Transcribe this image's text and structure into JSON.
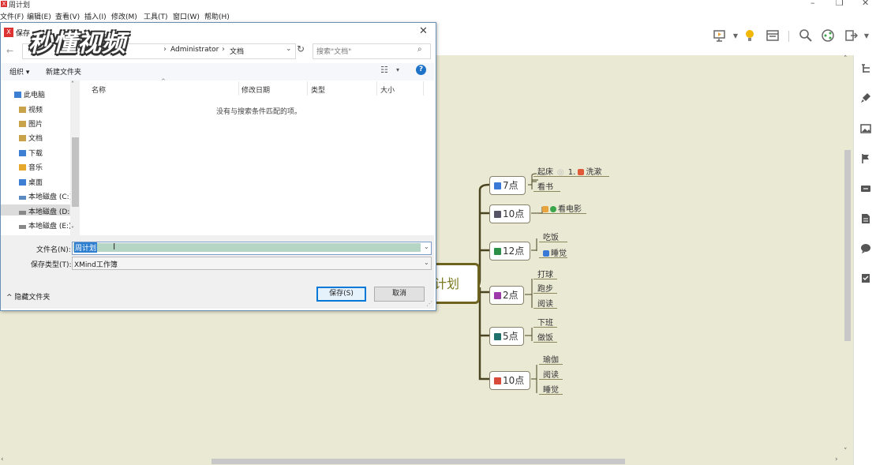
{
  "app": {
    "window_title": "周计划",
    "logo_glyph": "X",
    "win_minimize": "–",
    "win_restore": "❐",
    "win_close": "✕"
  },
  "menu": [
    "文件(F)",
    "编辑(E)",
    "查看(V)",
    "插入(I)",
    "修改(M)",
    "工具(T)",
    "窗口(W)",
    "帮助(H)"
  ],
  "toolbar_icons": [
    "presentation-icon",
    "lightbulb-icon",
    "layout-icon",
    "zoom-icon",
    "share-icon",
    "export-icon"
  ],
  "right_panel_icons": [
    "outline-icon",
    "format-brush-icon",
    "image-icon",
    "flag-icon",
    "label-icon",
    "note-icon",
    "comment-icon",
    "task-icon"
  ],
  "watermark": "秒懂视频",
  "dialog": {
    "title": "保存",
    "icon_glyph": "X",
    "close": "✕",
    "back": "←",
    "breadcrumb_sep": "›",
    "breadcrumb": [
      "Administrator",
      "文档"
    ],
    "address_dropdown": "⌄",
    "refresh": "↻",
    "search_placeholder": "搜索\"文档\"",
    "search_icon": "⌕",
    "organize": "组织 ▾",
    "new_folder": "新建文件夹",
    "view_icon": "☷",
    "view_dropdown": "▾",
    "help": "?",
    "nav_scroll_up": "˄",
    "nav_scroll_down": "˅",
    "nav_items": [
      {
        "label": "此电脑",
        "color": "#3c7fd3"
      },
      {
        "label": "视频",
        "color": "#c9a34a"
      },
      {
        "label": "图片",
        "color": "#c9a34a"
      },
      {
        "label": "文档",
        "color": "#c9a34a"
      },
      {
        "label": "下载",
        "color": "#3c7fd3"
      },
      {
        "label": "音乐",
        "color": "#e6a92e"
      },
      {
        "label": "桌面",
        "color": "#3c7fd3"
      },
      {
        "label": "本地磁盘 (C:)",
        "color": "#5a8ac0"
      },
      {
        "label": "本地磁盘 (D:)",
        "color": "#888888"
      },
      {
        "label": "本地磁盘 (E:)",
        "color": "#888888"
      }
    ],
    "selected_nav": "本地磁盘 (D:)",
    "columns": [
      "名称",
      "修改日期",
      "类型",
      "大小"
    ],
    "sort_caret": "^",
    "empty_message": "没有与搜索条件匹配的项。",
    "filename_label": "文件名(N):",
    "filename_value": "周计划",
    "dropdown_glyph": "⌄",
    "text_cursor": "I",
    "filetype_label": "保存类型(T):",
    "filetype_value": "XMind工作簿",
    "hide_folders": "^ 隐藏文件夹",
    "save_button": "保存(S)",
    "cancel_button": "取消",
    "resize_grip": "⋰"
  },
  "mindmap": {
    "central_label": "计划",
    "branches": [
      {
        "label": "7点",
        "marker": "#3a7ad6",
        "children": [
          {
            "label": "起床",
            "extra": "1.",
            "extra_badge": "#e05a3a",
            "extra_text": "洗漱"
          },
          {
            "label": "看书"
          }
        ]
      },
      {
        "label": "10点",
        "marker": "#555566",
        "children": [
          {
            "label": "看电影",
            "icons": [
              "#e8a33d",
              "#3aa54a"
            ]
          }
        ]
      },
      {
        "label": "12点",
        "marker": "#2b8f46",
        "children": [
          {
            "label": "吃饭"
          },
          {
            "label": "睡觉",
            "icons": [
              "#3a7ad6"
            ]
          }
        ]
      },
      {
        "label": "2点",
        "marker": "#9b3aa8",
        "children": [
          {
            "label": "打球"
          },
          {
            "label": "跑步"
          },
          {
            "label": "阅读"
          }
        ]
      },
      {
        "label": "5点",
        "marker": "#1f6f6a",
        "children": [
          {
            "label": "下班"
          },
          {
            "label": "做饭"
          }
        ]
      },
      {
        "label": "10点",
        "marker": "#d84b3b",
        "children": [
          {
            "label": "瑜伽"
          },
          {
            "label": "阅读"
          },
          {
            "label": "睡觉"
          }
        ]
      }
    ]
  },
  "scroll_glyphs": {
    "up": "˄",
    "down": "˅",
    "left": "‹",
    "right": "›"
  }
}
